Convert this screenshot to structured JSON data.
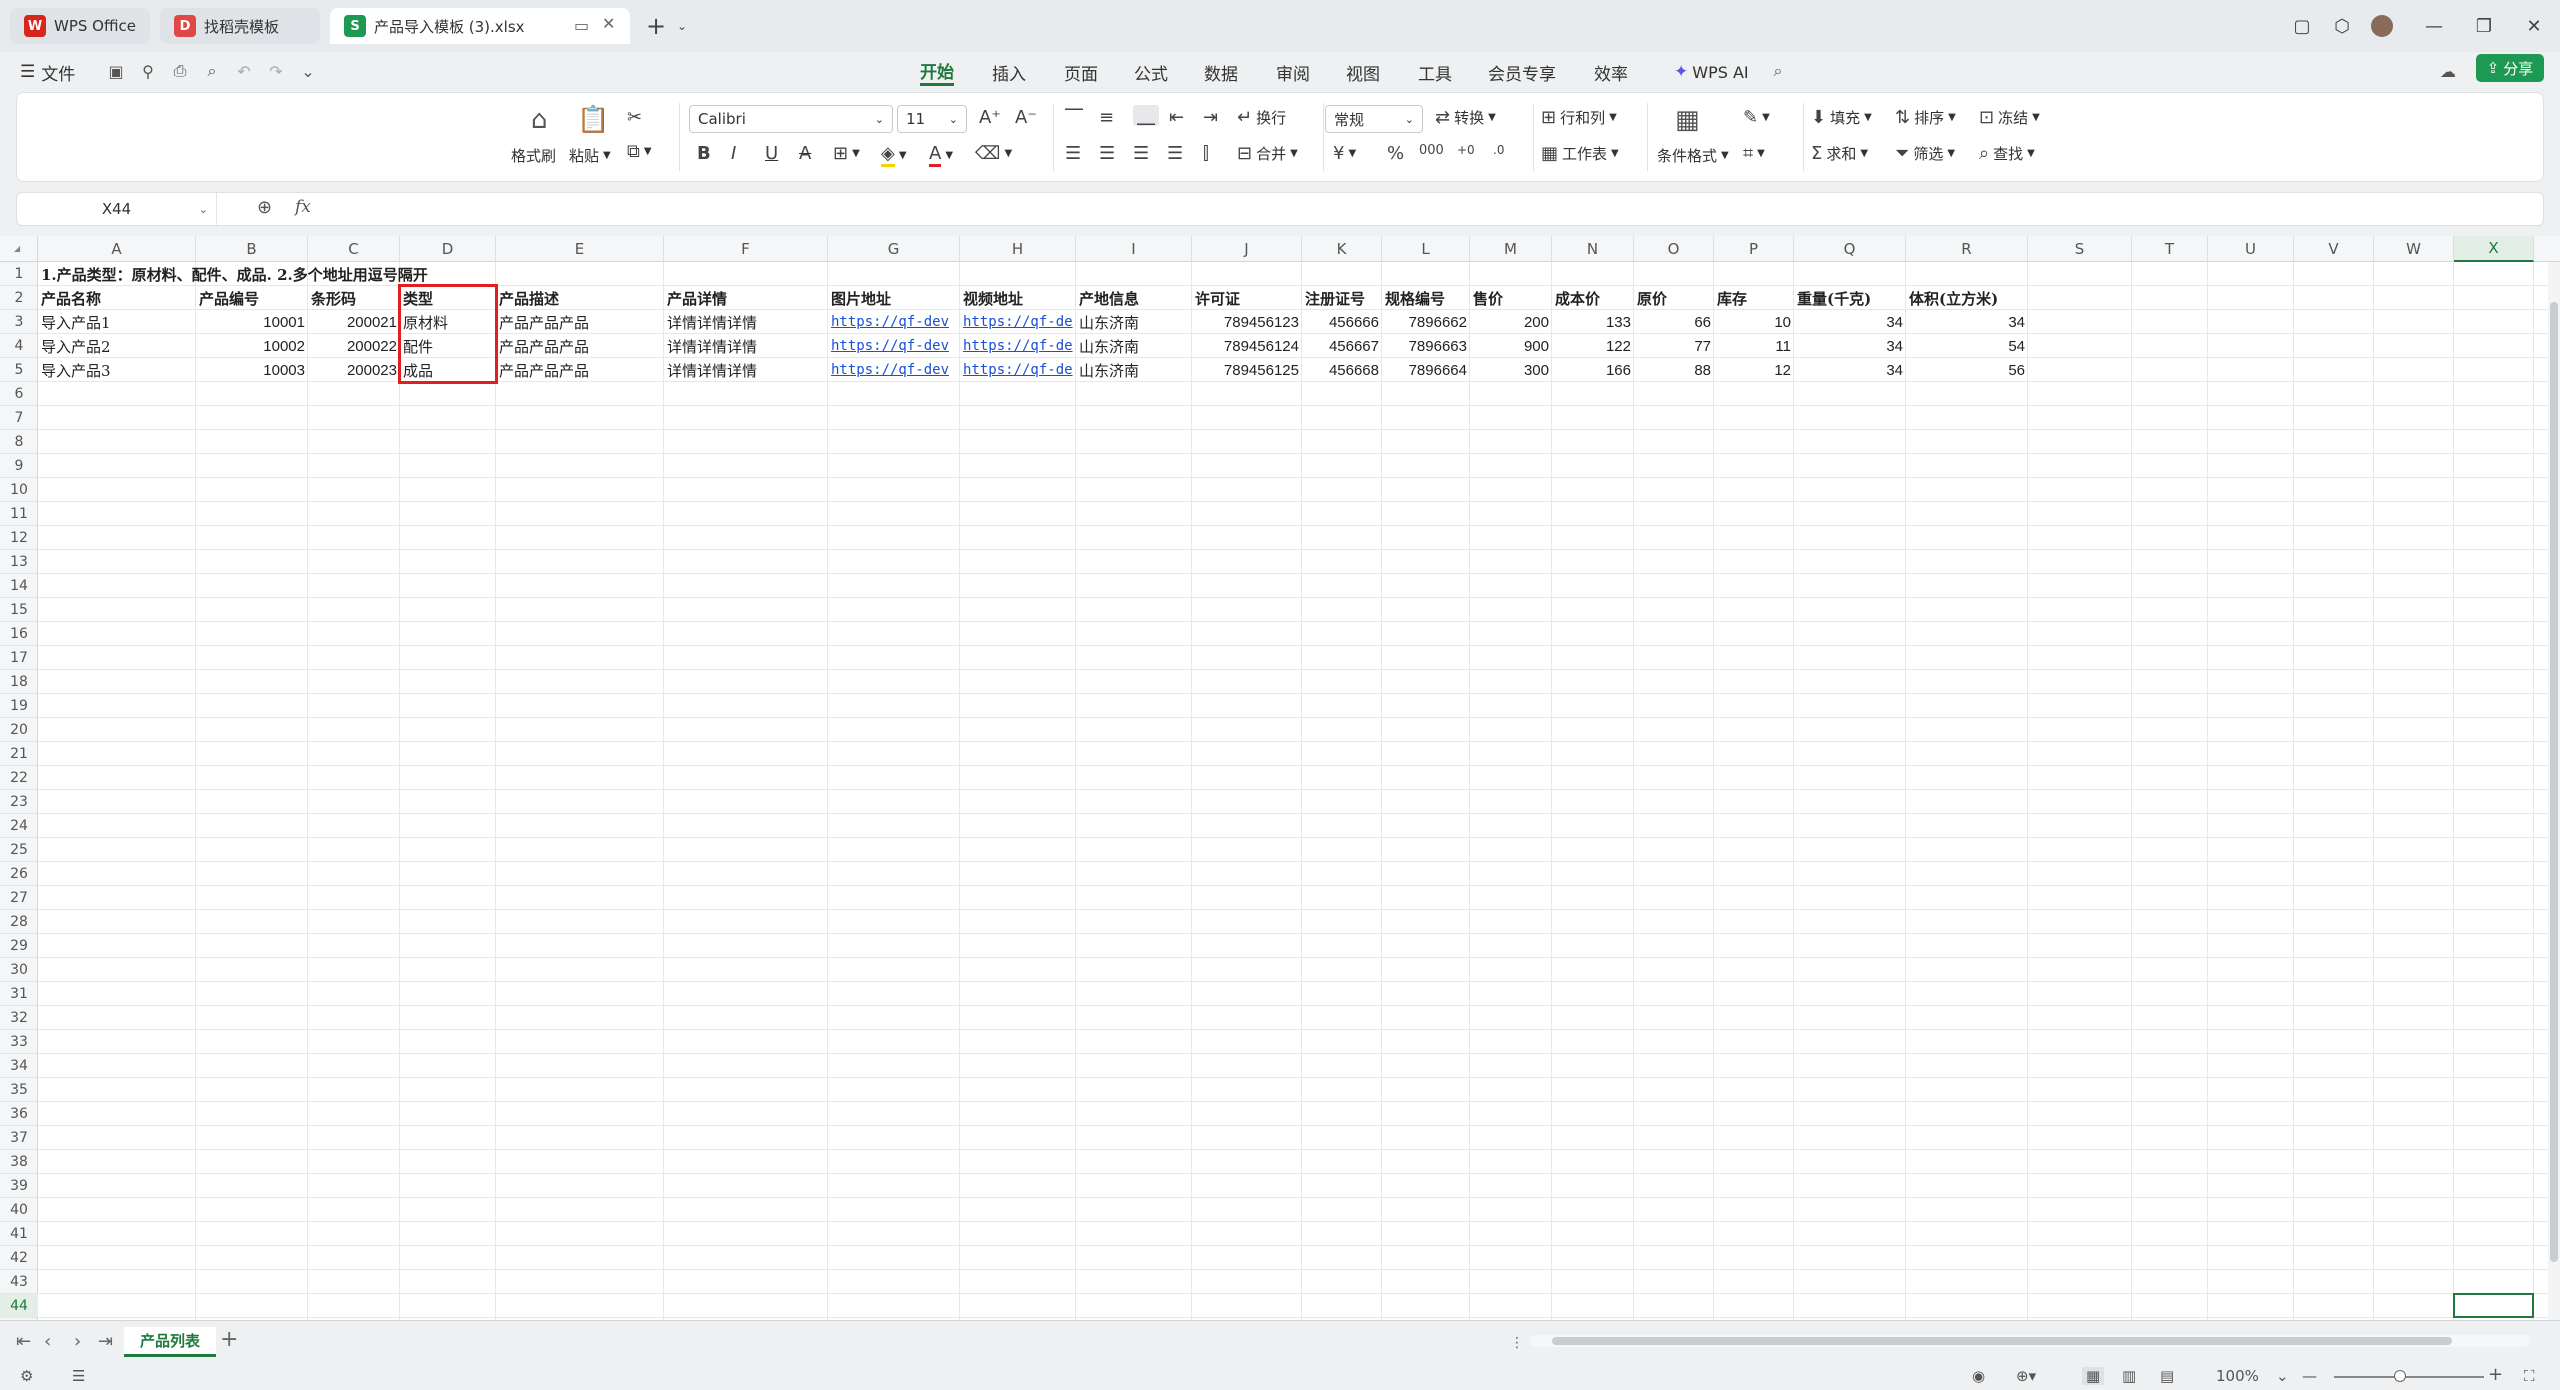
{
  "tabs": [
    {
      "label": "WPS Office",
      "icon": "wps-logo-icon"
    },
    {
      "label": "找稻壳模板",
      "icon": "docer-logo-icon"
    },
    {
      "label": "产品导入模板 (3).xlsx",
      "icon": "spreadsheet-s-icon"
    }
  ],
  "menu": {
    "file": "文件",
    "tabs": [
      "开始",
      "插入",
      "页面",
      "公式",
      "数据",
      "审阅",
      "视图",
      "工具",
      "会员专享",
      "效率"
    ],
    "active_tab": "开始",
    "wps_ai": "WPS AI",
    "share": "分享"
  },
  "ribbon": {
    "format_painter": "格式刷",
    "paste": "粘贴",
    "font_name": "Calibri",
    "font_size": "11",
    "wrap": "换行",
    "merge": "合并",
    "number_format": "常规",
    "convert": "转换",
    "row_col": "行和列",
    "worksheet": "工作表",
    "cond_format": "条件格式",
    "fill": "填充",
    "sort": "排序",
    "freeze": "冻结",
    "sum": "求和",
    "filter": "筛选",
    "find": "查找"
  },
  "formula_bar": {
    "name_box": "X44",
    "fx": "fx",
    "value": ""
  },
  "columns": [
    "A",
    "B",
    "C",
    "D",
    "E",
    "F",
    "G",
    "H",
    "I",
    "J",
    "K",
    "L",
    "M",
    "N",
    "O",
    "P",
    "Q",
    "R",
    "S",
    "T",
    "U",
    "V",
    "W",
    "X"
  ],
  "selected_column": "X",
  "selected_row": "44",
  "row_count": 44,
  "sheet": {
    "title": "1.产品类型：原材料、配件、成品. 2.多个地址用逗号隔开",
    "headers": [
      "产品名称",
      "产品编号",
      "条形码",
      "类型",
      "产品描述",
      "产品详情",
      "图片地址",
      "视频地址",
      "产地信息",
      "许可证",
      "注册证号",
      "规格编号",
      "售价",
      "成本价",
      "原价",
      "库存",
      "重量(千克)",
      "体积(立方米)"
    ],
    "rows": [
      [
        "导入产品1",
        "10001",
        "200021",
        "原材料",
        "产品产品产品",
        "详情详情详情",
        "https://qf-dev",
        "https://qf-de",
        "山东济南",
        "789456123",
        "456666",
        "7896662",
        "200",
        "133",
        "66",
        "10",
        "34",
        "34"
      ],
      [
        "导入产品2",
        "10002",
        "200022",
        "配件",
        "产品产品产品",
        "详情详情详情",
        "https://qf-dev",
        "https://qf-de",
        "山东济南",
        "789456124",
        "456667",
        "7896663",
        "900",
        "122",
        "77",
        "11",
        "34",
        "54"
      ],
      [
        "导入产品3",
        "10003",
        "200023",
        "成品",
        "产品产品产品",
        "详情详情详情",
        "https://qf-dev",
        "https://qf-de",
        "山东济南",
        "789456125",
        "456668",
        "7896664",
        "300",
        "166",
        "88",
        "12",
        "34",
        "56"
      ]
    ]
  },
  "sheet_tabs": [
    "产品列表"
  ],
  "status": {
    "zoom": "100%"
  }
}
